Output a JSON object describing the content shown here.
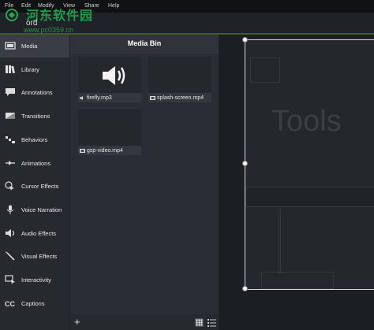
{
  "menubar": {
    "items": [
      "File",
      "Edit",
      "Modify",
      "View",
      "Share",
      "Help"
    ]
  },
  "watermark": {
    "name": "河东软件园",
    "url": "www.pc0359.cn",
    "partial_title": "ord"
  },
  "sidebar": {
    "items": [
      {
        "label": "Media",
        "icon": "film-icon",
        "active": true
      },
      {
        "label": "Library",
        "icon": "library-icon"
      },
      {
        "label": "Annotations",
        "icon": "annotation-icon"
      },
      {
        "label": "Transitions",
        "icon": "transition-icon"
      },
      {
        "label": "Behaviors",
        "icon": "behaviors-icon"
      },
      {
        "label": "Animations",
        "icon": "animation-icon"
      },
      {
        "label": "Cursor Effects",
        "icon": "cursor-icon"
      },
      {
        "label": "Voice Narration",
        "icon": "microphone-icon"
      },
      {
        "label": "Audio Effects",
        "icon": "speaker-icon"
      },
      {
        "label": "Visual Effects",
        "icon": "wand-icon"
      },
      {
        "label": "Interactivity",
        "icon": "interactivity-icon"
      },
      {
        "label": "Captions",
        "icon": "captions-icon"
      }
    ]
  },
  "bin": {
    "title": "Media Bin",
    "items": [
      {
        "name": "firefly.mp3",
        "type": "audio"
      },
      {
        "name": "splash-screen.mp4",
        "type": "video"
      },
      {
        "name": "gsp-video.mp4",
        "type": "video"
      }
    ],
    "add_label": "+"
  },
  "canvas": {
    "overlay_text": "Tools"
  },
  "colors": {
    "accent": "#7cc43a",
    "sidebar_bg": "#26292e",
    "bin_bg": "#2a2e34"
  }
}
